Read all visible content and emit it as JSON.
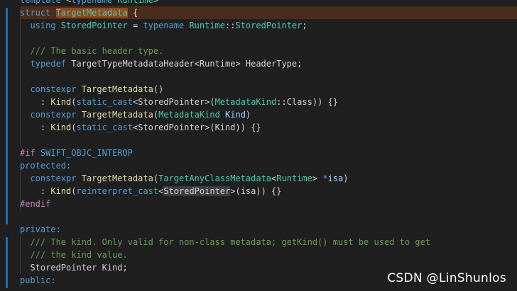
{
  "editor": {
    "lines": [
      {
        "tokens": [
          {
            "t": "template ",
            "c": "kw"
          },
          {
            "t": "<",
            "c": "pl"
          },
          {
            "t": "typename ",
            "c": "kw"
          },
          {
            "t": "Runtime",
            "c": "ty"
          },
          {
            "t": ">",
            "c": "pl"
          }
        ]
      },
      {
        "highlight": true,
        "tokens": [
          {
            "t": "struct ",
            "c": "kw"
          },
          {
            "t": "TargetMetadata",
            "c": "ty",
            "mark": true
          },
          {
            "t": " {",
            "c": "pl"
          }
        ]
      },
      {
        "tokens": [
          {
            "t": "  using ",
            "c": "kw"
          },
          {
            "t": "StoredPointer",
            "c": "ty"
          },
          {
            "t": " = ",
            "c": "pl"
          },
          {
            "t": "typename ",
            "c": "kw"
          },
          {
            "t": "Runtime",
            "c": "ty"
          },
          {
            "t": "::",
            "c": "pl"
          },
          {
            "t": "StoredPointer",
            "c": "ty"
          },
          {
            "t": ";",
            "c": "pl"
          }
        ]
      },
      {
        "tokens": []
      },
      {
        "tokens": [
          {
            "t": "  /// The basic header type.",
            "c": "cm"
          }
        ]
      },
      {
        "tokens": [
          {
            "t": "  typedef ",
            "c": "kw"
          },
          {
            "t": "TargetTypeMetadataHeader<Runtime> HeaderType;",
            "c": "pl"
          }
        ]
      },
      {
        "tokens": []
      },
      {
        "tokens": [
          {
            "t": "  constexpr ",
            "c": "kw"
          },
          {
            "t": "TargetMetadata",
            "c": "fn"
          },
          {
            "t": "()",
            "c": "pl"
          }
        ]
      },
      {
        "tokens": [
          {
            "t": "    : ",
            "c": "pl"
          },
          {
            "t": "Kind",
            "c": "fn"
          },
          {
            "t": "(",
            "c": "pl"
          },
          {
            "t": "static_cast",
            "c": "kw"
          },
          {
            "t": "<StoredPointer>(",
            "c": "pl"
          },
          {
            "t": "MetadataKind",
            "c": "ty"
          },
          {
            "t": "::Class)) {}",
            "c": "pl"
          }
        ]
      },
      {
        "tokens": [
          {
            "t": "  constexpr ",
            "c": "kw"
          },
          {
            "t": "TargetMetadata",
            "c": "fn"
          },
          {
            "t": "(",
            "c": "pl"
          },
          {
            "t": "MetadataKind ",
            "c": "ty"
          },
          {
            "t": "Kind",
            "c": "id"
          },
          {
            "t": ")",
            "c": "pl"
          }
        ]
      },
      {
        "tokens": [
          {
            "t": "    : ",
            "c": "pl"
          },
          {
            "t": "Kind",
            "c": "fn"
          },
          {
            "t": "(",
            "c": "pl"
          },
          {
            "t": "static_cast",
            "c": "kw"
          },
          {
            "t": "<StoredPointer>(Kind)) {}",
            "c": "pl"
          }
        ]
      },
      {
        "tokens": []
      },
      {
        "tokens": [
          {
            "t": "#if ",
            "c": "pp"
          },
          {
            "t": "SWIFT_OBJC_INTEROP",
            "c": "mc"
          }
        ]
      },
      {
        "tokens": [
          {
            "t": "protected:",
            "c": "kw"
          }
        ]
      },
      {
        "tokens": [
          {
            "t": "  constexpr ",
            "c": "kw"
          },
          {
            "t": "TargetMetadata",
            "c": "fn"
          },
          {
            "t": "(",
            "c": "pl"
          },
          {
            "t": "TargetAnyClassMetadata",
            "c": "ty"
          },
          {
            "t": "<",
            "c": "pl"
          },
          {
            "t": "Runtime",
            "c": "ty"
          },
          {
            "t": "> ",
            "c": "pl"
          },
          {
            "t": "*",
            "c": "kw"
          },
          {
            "t": "isa",
            "c": "id"
          },
          {
            "t": ")",
            "c": "pl"
          }
        ]
      },
      {
        "tokens": [
          {
            "t": "    : ",
            "c": "pl"
          },
          {
            "t": "Kind",
            "c": "fn"
          },
          {
            "t": "(",
            "c": "pl"
          },
          {
            "t": "reinterpret_cast",
            "c": "kw"
          },
          {
            "t": "<",
            "c": "pl"
          },
          {
            "t": "StoredPointer",
            "c": "pl",
            "sel": true
          },
          {
            "t": ">(isa)) {}",
            "c": "pl"
          }
        ]
      },
      {
        "tokens": [
          {
            "t": "#endif",
            "c": "pp"
          }
        ]
      },
      {
        "tokens": []
      },
      {
        "tokens": [
          {
            "t": "private:",
            "c": "kw"
          }
        ]
      },
      {
        "tokens": [
          {
            "t": "  /// The kind. Only valid for non-class metadata; getKind() must be used to get",
            "c": "cm"
          }
        ]
      },
      {
        "tokens": [
          {
            "t": "  /// the kind value.",
            "c": "cm"
          }
        ]
      },
      {
        "tokens": [
          {
            "t": "  StoredPointer Kind;",
            "c": "pl"
          }
        ]
      },
      {
        "tokens": [
          {
            "t": "public:",
            "c": "kw"
          }
        ]
      }
    ]
  },
  "watermark": "CSDN @LinShunlos"
}
